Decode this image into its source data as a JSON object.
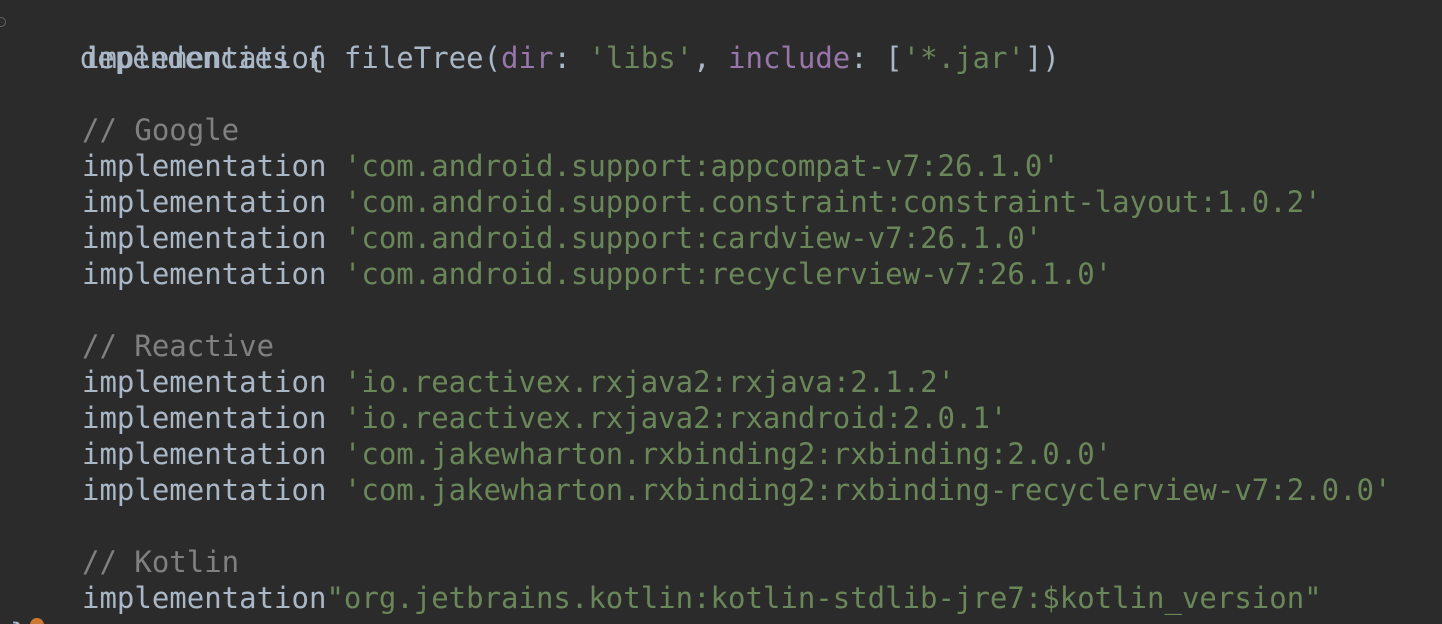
{
  "editor": {
    "lines": [
      {
        "type": "block-open",
        "text": "dependencies {"
      },
      {
        "type": "filetree",
        "kw": "implementation",
        "fn": "fileTree(",
        "arg1_name": "dir",
        "arg1_sep": ": ",
        "arg1_val": "'libs'",
        "comma": ", ",
        "arg2_name": "include",
        "arg2_sep": ": [",
        "arg2_val": "'*.jar'",
        "close": "])"
      },
      {
        "type": "blank"
      },
      {
        "type": "comment",
        "text": "// Google"
      },
      {
        "type": "dep",
        "kw": "implementation",
        "space": " ",
        "value": "'com.android.support:appcompat-v7:26.1.0'"
      },
      {
        "type": "dep",
        "kw": "implementation",
        "space": " ",
        "value": "'com.android.support.constraint:constraint-layout:1.0.2'"
      },
      {
        "type": "dep",
        "kw": "implementation",
        "space": " ",
        "value": "'com.android.support:cardview-v7:26.1.0'"
      },
      {
        "type": "dep",
        "kw": "implementation",
        "space": " ",
        "value": "'com.android.support:recyclerview-v7:26.1.0'"
      },
      {
        "type": "blank"
      },
      {
        "type": "comment",
        "text": "// Reactive"
      },
      {
        "type": "dep",
        "kw": "implementation",
        "space": " ",
        "value": "'io.reactivex.rxjava2:rxjava:2.1.2'"
      },
      {
        "type": "dep",
        "kw": "implementation",
        "space": " ",
        "value": "'io.reactivex.rxjava2:rxandroid:2.0.1'"
      },
      {
        "type": "dep",
        "kw": "implementation",
        "space": " ",
        "value": "'com.jakewharton.rxbinding2:rxbinding:2.0.0'"
      },
      {
        "type": "dep",
        "kw": "implementation",
        "space": " ",
        "value": "'com.jakewharton.rxbinding2:rxbinding-recyclerview-v7:2.0.0'"
      },
      {
        "type": "blank"
      },
      {
        "type": "comment",
        "text": "// Kotlin"
      },
      {
        "type": "dep",
        "kw": "implementation",
        "space": "",
        "value": "\"org.jetbrains.kotlin:kotlin-stdlib-jre7:$kotlin_version\""
      }
    ],
    "closing_brace": "}"
  }
}
